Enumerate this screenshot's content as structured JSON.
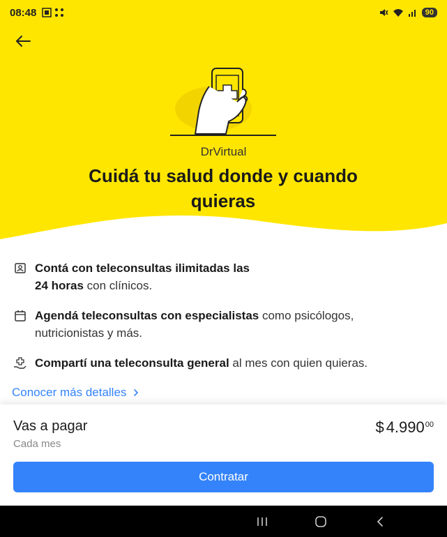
{
  "status_bar": {
    "time": "08:48",
    "battery": "90"
  },
  "header": {
    "back_icon": "arrow-left-icon"
  },
  "hero": {
    "brand": "DrVirtual",
    "headline": "Cuidá tu salud donde y cuando quieras",
    "illustration": "phone-medical-cross-icon",
    "bg_color": "#ffe600"
  },
  "features": [
    {
      "icon": "person-badge-icon",
      "bold": "Contá con teleconsultas ilimitadas las",
      "bold2": "24 horas",
      "rest": " con clínicos."
    },
    {
      "icon": "calendar-icon",
      "bold": "Agendá teleconsultas con especialistas",
      "rest": " como psicólogos, nutricionistas y más."
    },
    {
      "icon": "hand-medical-icon",
      "bold": "Compartí una teleconsulta general",
      "rest": " al mes con quien quieras."
    }
  ],
  "more_link": {
    "label": "Conocer más detalles",
    "icon": "chevron-right-icon"
  },
  "payment": {
    "label": "Vas a pagar",
    "period": "Cada mes",
    "currency": "$",
    "amount": "4.990",
    "cents": "00"
  },
  "cta": {
    "label": "Contratar",
    "color": "#3483fa"
  },
  "nav": {
    "recents_icon": "recents-icon",
    "home_icon": "home-icon",
    "back_icon": "back-icon"
  }
}
